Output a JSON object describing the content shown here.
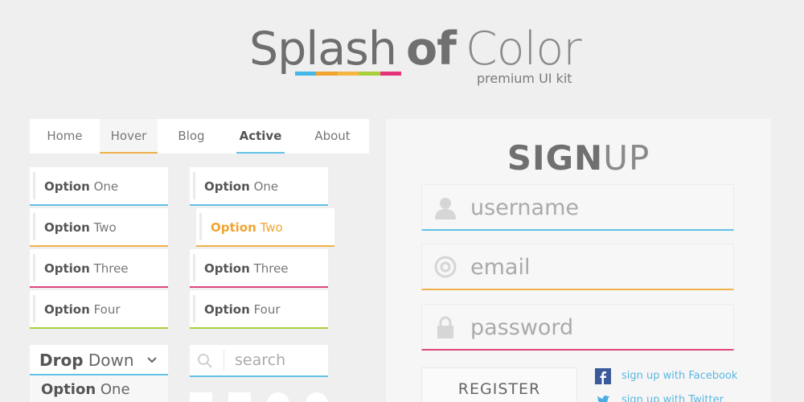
{
  "header": {
    "title_part1": "Splash",
    "title_part2": "of",
    "title_part3": "Color",
    "subtitle": "premium UI kit",
    "bar_colors": [
      "#45b8e8",
      "#f0a531",
      "#f3b640",
      "#a9cf3c",
      "#e6327a"
    ]
  },
  "nav": {
    "items": [
      {
        "label": "Home",
        "state": "normal"
      },
      {
        "label": "Hover",
        "state": "hover"
      },
      {
        "label": "Blog",
        "state": "normal"
      },
      {
        "label": "Active",
        "state": "active"
      },
      {
        "label": "About",
        "state": "normal"
      }
    ]
  },
  "options_left": [
    {
      "bold": "Option",
      "rest": " One",
      "accent": "#62c2e6"
    },
    {
      "bold": "Option",
      "rest": " Two",
      "accent": "#f0b04a"
    },
    {
      "bold": "Option",
      "rest": " Three",
      "accent": "#e0467f"
    },
    {
      "bold": "Option",
      "rest": " Four",
      "accent": "#a9cf3c"
    }
  ],
  "options_right": [
    {
      "bold": "Option",
      "rest": " One",
      "accent": "#62c2e6"
    },
    {
      "bold": "Option",
      "rest": " Two",
      "accent": "#f0b04a",
      "highlight": true
    },
    {
      "bold": "Option",
      "rest": " Three",
      "accent": "#e0467f"
    },
    {
      "bold": "Option",
      "rest": " Four",
      "accent": "#a9cf3c"
    }
  ],
  "dropdown": {
    "label_bold": "Drop",
    "label_rest": " Down",
    "option_bold": "Option",
    "option_rest": " One",
    "icon": "chevron-down-icon"
  },
  "search": {
    "placeholder": "search",
    "icon": "search-icon"
  },
  "signup": {
    "title_bold": "SIGN",
    "title_light": "UP",
    "fields": [
      {
        "placeholder": "username",
        "icon": "user-icon",
        "accent": "#62c2e6"
      },
      {
        "placeholder": "email",
        "icon": "at-icon",
        "accent": "#f0b04a"
      },
      {
        "placeholder": "password",
        "icon": "lock-icon",
        "accent": "#e0467f"
      }
    ],
    "register_label": "REGISTER",
    "facebook_label": "sign up with Facebook",
    "twitter_label": "sign up with Twitter",
    "facebook_color": "#3b5a9a",
    "twitter_color": "#4aaee5"
  }
}
